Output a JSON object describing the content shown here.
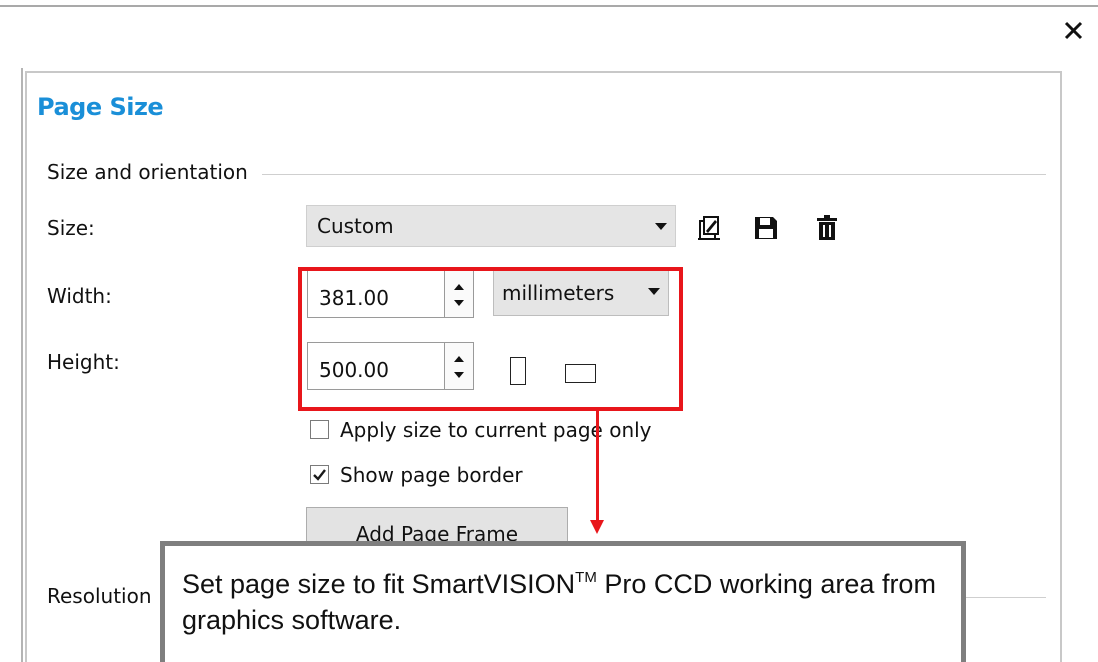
{
  "dialog": {
    "title": "Page Size",
    "section_size": "Size and orientation",
    "section_resolution": "Resolution"
  },
  "size": {
    "label": "Size:",
    "value": "Custom",
    "icons": [
      "edit-preset-icon",
      "save-preset-icon",
      "delete-preset-icon"
    ]
  },
  "width": {
    "label": "Width:",
    "value": "381.00",
    "unit": "millimeters"
  },
  "height": {
    "label": "Height:",
    "value": "500.00"
  },
  "options": {
    "apply_current_page": {
      "label": "Apply size to current page only",
      "checked": false
    },
    "show_border": {
      "label": "Show page border",
      "checked": true
    }
  },
  "add_frame_button": "Add Page Frame",
  "annotation": {
    "text_before": "Set page size to fit SmartVISION",
    "superscript": "TM",
    "text_after": " Pro CCD working area from graphics software.",
    "highlight_color": "#e8161b",
    "box_color": "#7f7f7f"
  },
  "colors": {
    "title": "#1a8fd8",
    "checkmark": "#1a1a1a"
  }
}
